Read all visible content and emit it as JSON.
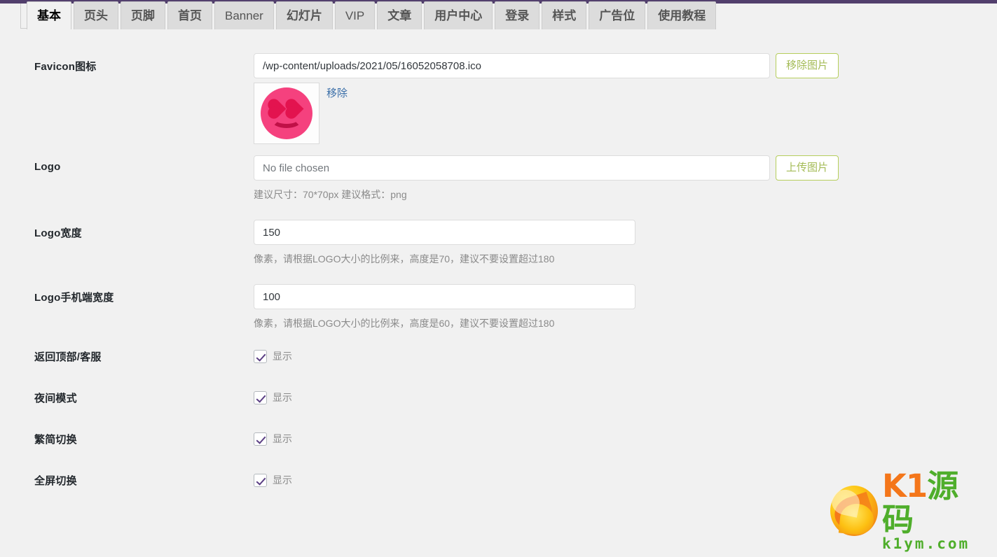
{
  "adminbar": {
    "color": "#523f6d"
  },
  "tabs": [
    {
      "label": "基本",
      "active": true,
      "latin": false
    },
    {
      "label": "页头",
      "active": false,
      "latin": false
    },
    {
      "label": "页脚",
      "active": false,
      "latin": false
    },
    {
      "label": "首页",
      "active": false,
      "latin": false
    },
    {
      "label": "Banner",
      "active": false,
      "latin": true
    },
    {
      "label": "幻灯片",
      "active": false,
      "latin": false
    },
    {
      "label": "VIP",
      "active": false,
      "latin": true
    },
    {
      "label": "文章",
      "active": false,
      "latin": false
    },
    {
      "label": "用户中心",
      "active": false,
      "latin": false
    },
    {
      "label": "登录",
      "active": false,
      "latin": false
    },
    {
      "label": "样式",
      "active": false,
      "latin": false
    },
    {
      "label": "广告位",
      "active": false,
      "latin": false
    },
    {
      "label": "使用教程",
      "active": false,
      "latin": false
    }
  ],
  "fields": {
    "favicon": {
      "label": "Favicon图标",
      "value": "/wp-content/uploads/2021/05/16052058708.ico",
      "placeholder": "",
      "button": "移除图片",
      "remove_link": "移除",
      "preview_icon": "pink-smiley-heart-eyes-favicon"
    },
    "logo": {
      "label": "Logo",
      "value": "",
      "placeholder": "No file chosen",
      "button": "上传图片",
      "hint": "建议尺寸：70*70px 建议格式：png"
    },
    "logo_width": {
      "label": "Logo宽度",
      "value": "150",
      "hint": "像素，请根据LOGO大小的比例来，高度是70，建议不要设置超过180"
    },
    "logo_mobile_width": {
      "label": "Logo手机端宽度",
      "value": "100",
      "hint": "像素，请根据LOGO大小的比例来，高度是60，建议不要设置超过180"
    }
  },
  "toggles": [
    {
      "label": "返回顶部/客服",
      "checkbox_label": "显示",
      "checked": true
    },
    {
      "label": "夜间模式",
      "checkbox_label": "显示",
      "checked": true
    },
    {
      "label": "繁简切换",
      "checkbox_label": "显示",
      "checked": true
    },
    {
      "label": "全屏切换",
      "checkbox_label": "显示",
      "checked": true
    }
  ],
  "watermark": {
    "brand_k1": "K1",
    "brand_cn": "源码",
    "domain": "k1ym.com",
    "color_orange": "#f4761a",
    "color_green": "#4fae2b"
  }
}
